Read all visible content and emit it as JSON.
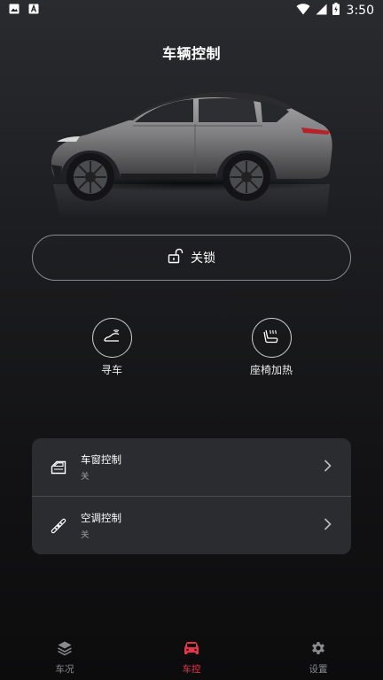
{
  "status_bar": {
    "time": "3:50",
    "left_icons": [
      "image-icon",
      "text-icon"
    ],
    "right_icons": [
      "wifi-icon",
      "signal-icon",
      "battery-charging-icon"
    ]
  },
  "page": {
    "title": "车辆控制"
  },
  "lock_button": {
    "label": "关锁",
    "icon": "unlock-icon"
  },
  "quick_actions": [
    {
      "label": "寻车",
      "icon": "find-car-icon"
    },
    {
      "label": "座椅加热",
      "icon": "seat-heat-icon"
    }
  ],
  "controls": [
    {
      "title": "车窗控制",
      "status": "关",
      "icon": "window-icon"
    },
    {
      "title": "空调控制",
      "status": "关",
      "icon": "fan-icon"
    }
  ],
  "bottom_nav": [
    {
      "label": "车况",
      "icon": "layers-icon",
      "active": false
    },
    {
      "label": "车控",
      "icon": "car-icon",
      "active": true
    },
    {
      "label": "设置",
      "icon": "gear-icon",
      "active": false
    }
  ],
  "colors": {
    "accent": "#e8344b",
    "background": "#121214",
    "card": "#2b2c2f"
  }
}
